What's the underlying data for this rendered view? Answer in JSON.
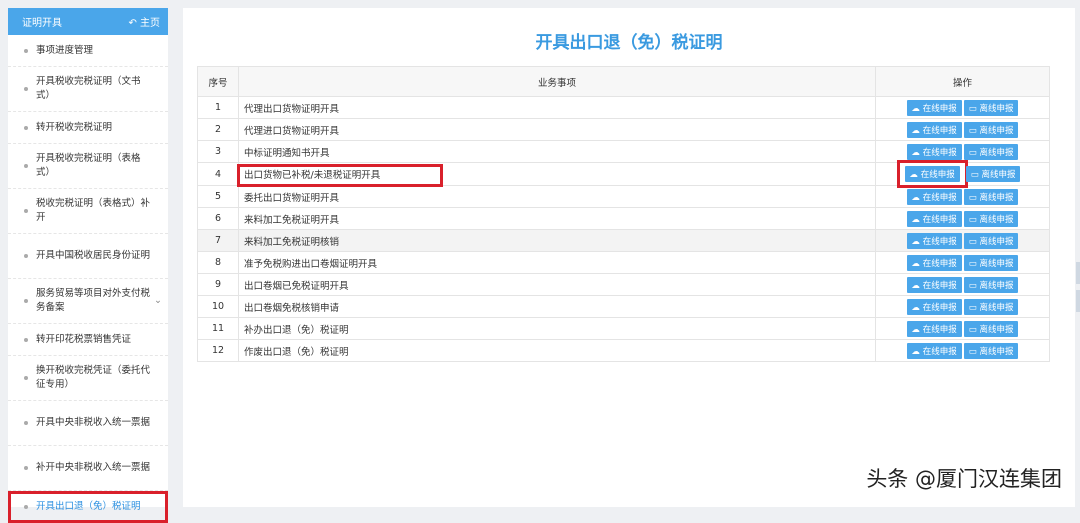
{
  "sidebar": {
    "title": "证明开具",
    "home": "主页",
    "items": [
      "事项进度管理",
      "开具税收完税证明（文书式）",
      "转开税收完税证明",
      "开具税收完税证明（表格式）",
      "税收完税证明（表格式）补开",
      "开具中国税收居民身份证明",
      "服务贸易等项目对外支付税务备案",
      "转开印花税票销售凭证",
      "换开税收完税凭证（委托代征专用）",
      "开具中央非税收入统一票据",
      "补开中央非税收入统一票据",
      "开具出口退（免）税证明"
    ]
  },
  "main": {
    "title": "开具出口退（免）税证明",
    "headers": [
      "序号",
      "业务事项",
      "操作"
    ],
    "online": "在线申报",
    "offline": "离线申报",
    "rows": [
      [
        "1",
        "代理出口货物证明开具"
      ],
      [
        "2",
        "代理进口货物证明开具"
      ],
      [
        "3",
        "中标证明通知书开具"
      ],
      [
        "4",
        "出口货物已补税/未退税证明开具"
      ],
      [
        "5",
        "委托出口货物证明开具"
      ],
      [
        "6",
        "来料加工免税证明开具"
      ],
      [
        "7",
        "来料加工免税证明核销"
      ],
      [
        "8",
        "准予免税购进出口卷烟证明开具"
      ],
      [
        "9",
        "出口卷烟已免税证明开具"
      ],
      [
        "10",
        "出口卷烟免税核销申请"
      ],
      [
        "11",
        "补办出口退（免）税证明"
      ],
      [
        "12",
        "作废出口退（免）税证明"
      ]
    ]
  },
  "watermark": "头条 @厦门汉连集团"
}
